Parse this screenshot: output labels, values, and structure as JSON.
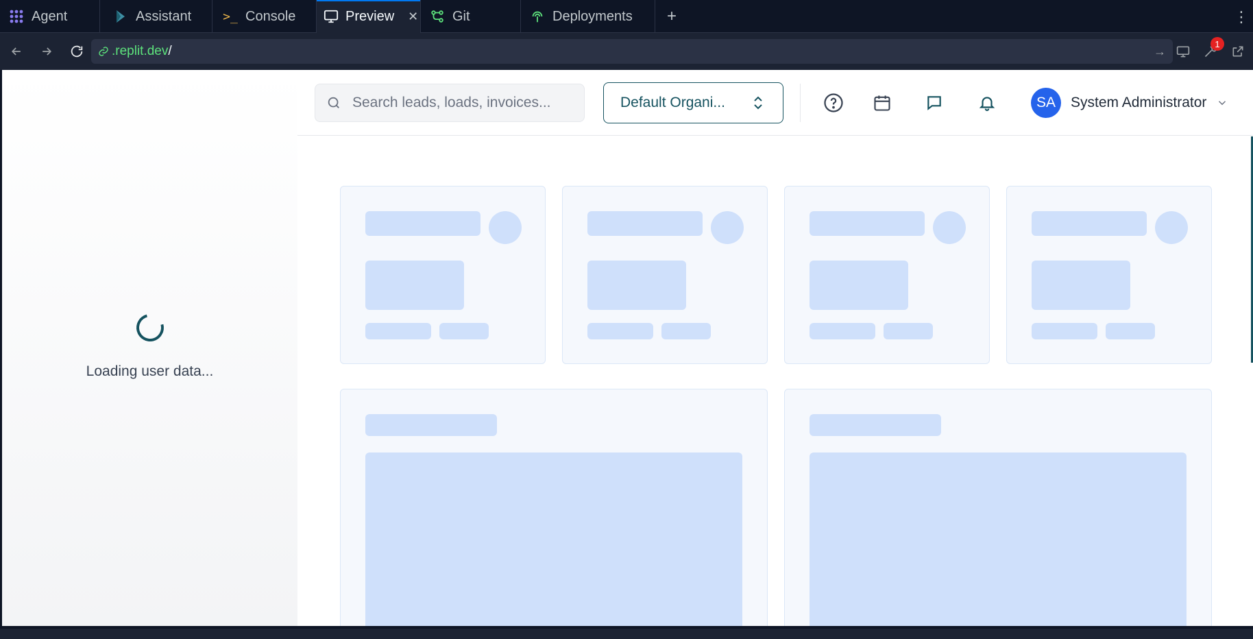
{
  "tabs": [
    {
      "label": "Agent",
      "icon": "agent-icon"
    },
    {
      "label": "Assistant",
      "icon": "assistant-icon"
    },
    {
      "label": "Console",
      "icon": "console-icon"
    },
    {
      "label": "Preview",
      "icon": "monitor-icon",
      "active": true
    },
    {
      "label": "Git",
      "icon": "git-icon"
    },
    {
      "label": "Deployments",
      "icon": "deployments-icon"
    }
  ],
  "address": {
    "host": ".replit.dev",
    "path": "/"
  },
  "notifications_badge": "1",
  "sidebar": {
    "loading_text": "Loading user data..."
  },
  "header": {
    "search_placeholder": "Search leads, loads, invoices...",
    "org_label": "Default Organi...",
    "user_initials": "SA",
    "user_name": "System Administrator"
  },
  "colors": {
    "accent": "#15525f",
    "avatar": "#2563eb",
    "skeleton": "#cfe0fb",
    "tab_active_indicator": "#0079f2"
  }
}
